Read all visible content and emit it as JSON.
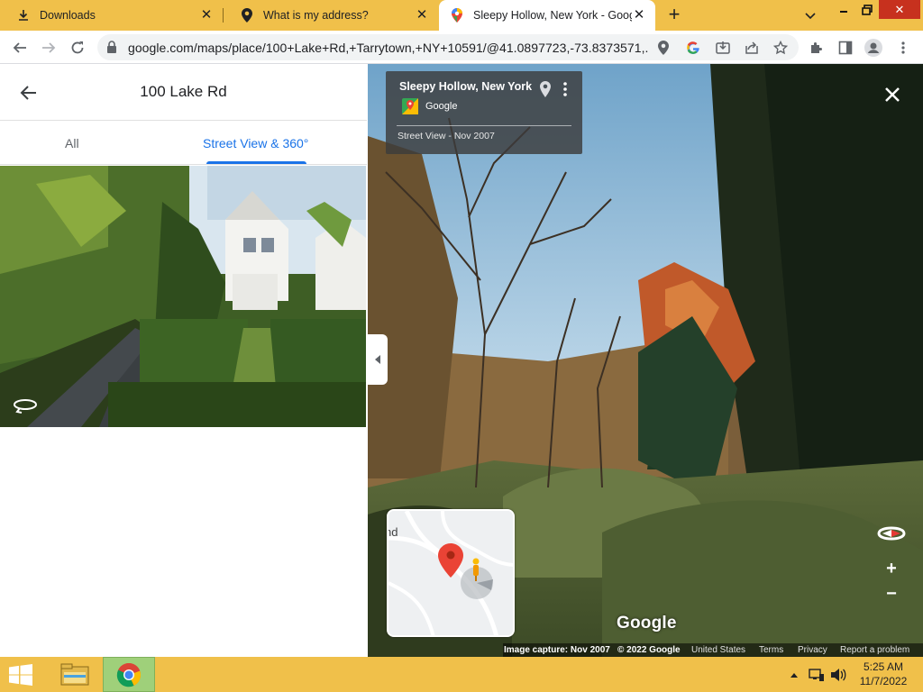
{
  "browser": {
    "tabs": [
      {
        "title": "Downloads",
        "icon": "download-icon"
      },
      {
        "title": "What is my address?",
        "icon": "location-pin-icon"
      },
      {
        "title": "Sleepy Hollow, New York - Goog",
        "icon": "google-maps-icon",
        "active": true
      }
    ],
    "new_tab_label": "+",
    "url": "google.com/maps/place/100+Lake+Rd,+Tarrytown,+NY+10591/@41.0897723,-73.8373571,..."
  },
  "left_panel": {
    "title": "100 Lake Rd",
    "tabs": [
      {
        "label": "All",
        "active": false
      },
      {
        "label": "Street View & 360°",
        "active": true
      }
    ]
  },
  "street_view": {
    "card": {
      "title": "Sleepy Hollow, New York",
      "source": "Google",
      "date_line": "Street View - Nov 2007"
    },
    "minimap_label": "nd",
    "logo": "Google",
    "attribution": {
      "capture": "Image capture: Nov 2007",
      "copyright": "© 2022 Google",
      "country": "United States",
      "terms": "Terms",
      "privacy": "Privacy",
      "report": "Report a problem"
    },
    "zoom_in": "+",
    "zoom_out": "−"
  },
  "taskbar": {
    "time": "5:25 AM",
    "date": "11/7/2022"
  },
  "colors": {
    "chrome_frame": "#f0c04a",
    "accent_blue": "#1a73e8",
    "close_red": "#c7311e"
  }
}
